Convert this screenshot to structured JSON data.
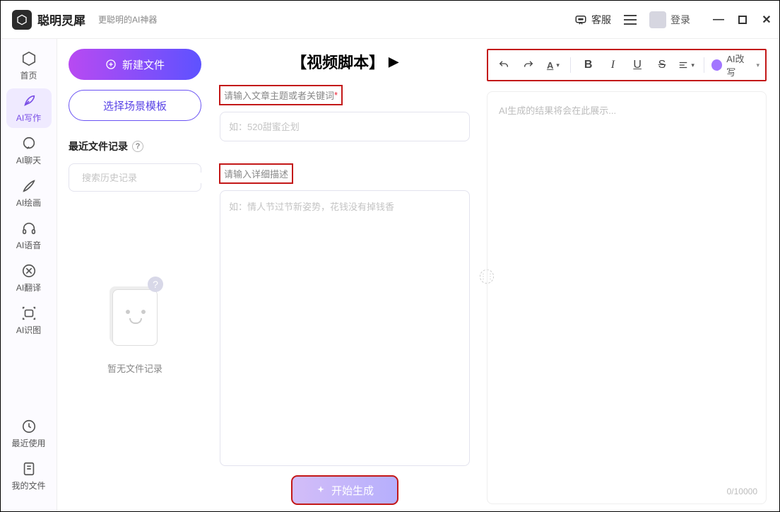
{
  "titlebar": {
    "app_name": "聪明灵犀",
    "app_tagline": "更聪明的AI神器",
    "kefu_label": "客服",
    "login_label": "登录"
  },
  "nav": {
    "items": [
      {
        "label": "首页"
      },
      {
        "label": "AI写作"
      },
      {
        "label": "AI聊天"
      },
      {
        "label": "AI绘画"
      },
      {
        "label": "AI语音"
      },
      {
        "label": "AI翻译"
      },
      {
        "label": "AI识图"
      }
    ],
    "bottom": [
      {
        "label": "最近使用"
      },
      {
        "label": "我的文件"
      }
    ]
  },
  "col2": {
    "new_file_label": "新建文件",
    "select_template_label": "选择场景模板",
    "recent_title": "最近文件记录",
    "search_placeholder": "搜索历史记录",
    "empty_text": "暂无文件记录"
  },
  "col3": {
    "heading": "【视频脚本】",
    "label_topic": "请输入文章主题或者关键词",
    "placeholder_topic": "如：520甜蜜企划",
    "label_detail": "请输入详细描述",
    "placeholder_detail": "如：情人节过节新姿势，花钱没有掉钱香",
    "generate_label": "开始生成"
  },
  "col4": {
    "ai_rewrite_label": "AI改写",
    "editor_placeholder": "AI生成的结果将会在此展示...",
    "char_count": "0/10000"
  }
}
